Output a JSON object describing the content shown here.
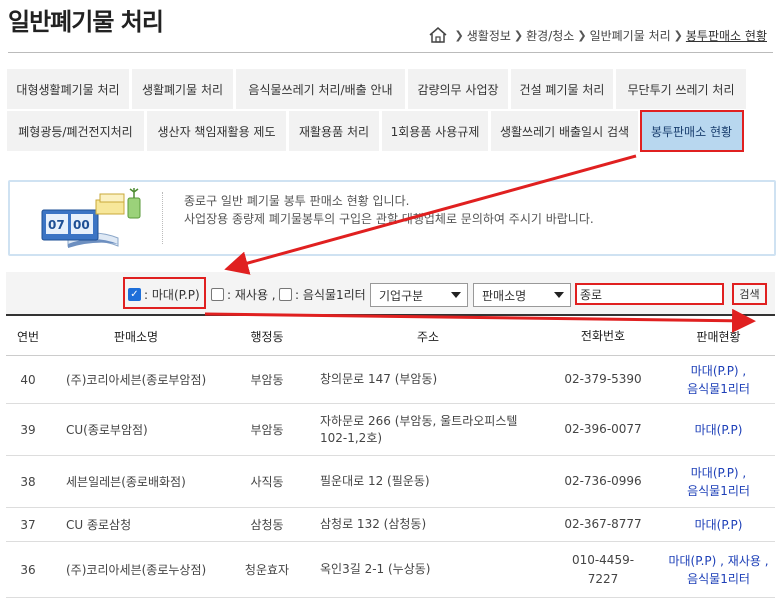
{
  "page": {
    "title": "일반폐기물 처리"
  },
  "breadcrumb": {
    "items": [
      "생활정보",
      "환경/청소",
      "일반폐기물 처리",
      "봉투판매소 현황"
    ]
  },
  "tabs": {
    "row1": [
      "대형생활폐기물 처리",
      "생활폐기물 처리",
      "음식물쓰레기 처리/배출 안내",
      "감량의무 사업장",
      "건설 폐기물 처리",
      "무단투기 쓰레기 처리"
    ],
    "row2": [
      "폐형광등/폐건전지처리",
      "생산자 책임재활용 제도",
      "재활용품 처리",
      "1회용품 사용규제",
      "생활쓰레기 배출일시 검색",
      "봉투판매소 현황"
    ]
  },
  "info": {
    "illus_digits": [
      "07",
      "00"
    ],
    "line1": "종로구 일반 폐기물 봉투 판매소 현황 입니다.",
    "line2": "사업장용 종량제 폐기물봉투의 구입은 관할 대행업체로 문의하여 주시기 바랍니다."
  },
  "filters": {
    "check_madae": {
      "label": ": 마대(P.P)",
      "checked": true
    },
    "check_reuse": {
      "label": ": 재사용 ,",
      "checked": false
    },
    "check_food": {
      "label": ": 음식물1리터",
      "checked": false
    },
    "select_company": "기업구분",
    "select_field": "판매소명",
    "search_value": "종로",
    "search_button": "검색"
  },
  "table": {
    "headers": [
      "연번",
      "판매소명",
      "행정동",
      "주소",
      "전화번호",
      "판매현황"
    ],
    "rows": [
      {
        "no": "40",
        "name": "(주)코리아세븐(종로부암점)",
        "dong": "부암동",
        "address": "창의문로 147 (부암동)",
        "phone": "02-379-5390",
        "status": "마대(P.P) ,\n음식물1리터"
      },
      {
        "no": "39",
        "name": "CU(종로부암점)",
        "dong": "부암동",
        "address": "자하문로 266 (부암동, 울트라오피스텔102-1,2호)",
        "phone": "02-396-0077",
        "status": "마대(P.P)"
      },
      {
        "no": "38",
        "name": "세븐일레븐(종로배화점)",
        "dong": "사직동",
        "address": "필운대로 12 (필운동)",
        "phone": "02-736-0996",
        "status": "마대(P.P) ,\n음식물1리터"
      },
      {
        "no": "37",
        "name": "CU 종로삼청",
        "dong": "삼청동",
        "address": "삼청로 132 (삼청동)",
        "phone": "02-367-8777",
        "status": "마대(P.P)"
      },
      {
        "no": "36",
        "name": "(주)코리아세븐(종로누상점)",
        "dong": "청운효자",
        "address": "옥인3길 2-1 (누상동)",
        "phone": "010-4459-\n7227",
        "status": "마대(P.P) , 재사용 ,\n음식물1리터"
      }
    ]
  },
  "colors": {
    "accent": "#1e40b8",
    "highlight": "#e02020",
    "active_tab": "#b8d7ef"
  }
}
